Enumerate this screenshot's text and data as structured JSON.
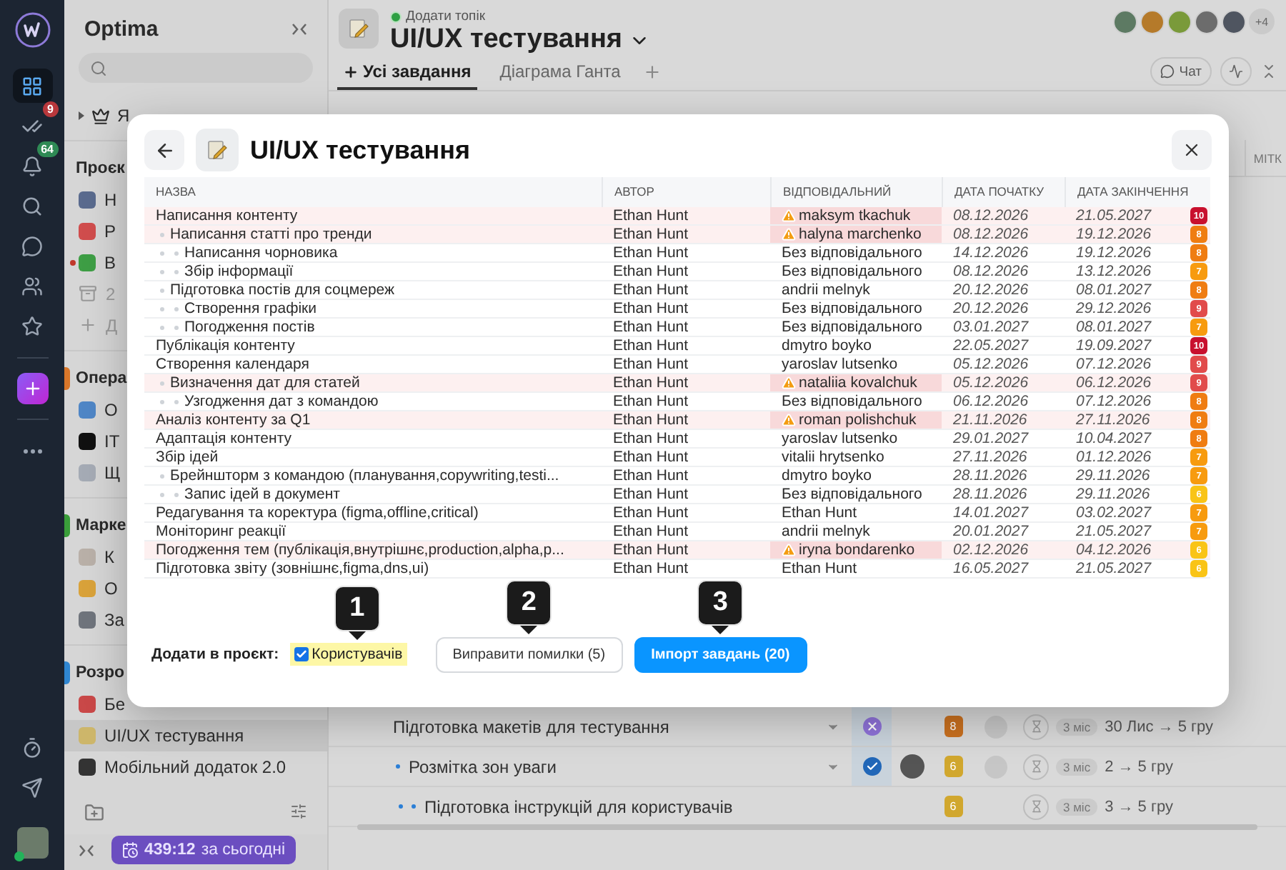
{
  "rail": {
    "top": [
      {
        "kind": "grid",
        "selected": true
      },
      {
        "kind": "tasks",
        "selected": false,
        "badge": "9",
        "color": "#b8383c"
      },
      {
        "kind": "bell",
        "selected": false,
        "badge": "64",
        "color": "#2f8a55"
      },
      {
        "kind": "search",
        "selected": false
      },
      {
        "kind": "chat",
        "selected": false
      },
      {
        "kind": "users",
        "selected": false
      },
      {
        "kind": "star",
        "selected": false
      }
    ],
    "middle": [
      {
        "kind": "add",
        "selected": false
      },
      {
        "kind": "more",
        "selected": false
      }
    ],
    "bottom": [
      {
        "kind": "timer",
        "selected": false
      },
      {
        "kind": "send",
        "selected": false
      }
    ]
  },
  "sidebar": {
    "title": "Optima",
    "favorites": {
      "label": "Я"
    },
    "sections": [
      {
        "label": "Проєк",
        "items": [
          {
            "label": "Н",
            "kind": "project",
            "color": "#5a6b8e",
            "selected": false,
            "unread": false
          },
          {
            "label": "Р",
            "kind": "project",
            "color": "#d04d4d",
            "selected": false,
            "unread": false
          },
          {
            "label": "В",
            "kind": "project",
            "color": "#3e9e45",
            "selected": false,
            "unread": true
          },
          {
            "label": "2",
            "kind": "archive",
            "selected": false,
            "unread": false
          },
          {
            "label": "Д",
            "kind": "add",
            "selected": false,
            "unread": false
          }
        ]
      },
      {
        "label": "Опера",
        "color": "#d9772a",
        "items": [
          {
            "label": "О",
            "kind": "project",
            "color": "#4f86c6",
            "selected": false,
            "unread": false
          },
          {
            "label": "IT",
            "kind": "project",
            "color": "#111111",
            "selected": false,
            "unread": false
          },
          {
            "label": "Щ",
            "kind": "project",
            "color": "#a5abb5",
            "selected": false,
            "unread": false
          }
        ]
      },
      {
        "label": "Марке",
        "color": "#3a9e3a",
        "items": [
          {
            "label": "К",
            "kind": "project",
            "color": "#b9b0a8",
            "selected": false,
            "unread": false
          },
          {
            "label": "О",
            "kind": "project",
            "color": "#d9a23a",
            "selected": false,
            "unread": false
          },
          {
            "label": "За",
            "kind": "project",
            "color": "#6f747c",
            "selected": false,
            "unread": false
          }
        ]
      },
      {
        "label": "Розро",
        "color": "#2f86d1",
        "items": [
          {
            "label": "Бе",
            "kind": "project",
            "color": "#c94848",
            "selected": false,
            "unread": false
          },
          {
            "label": "UI/UX тестування",
            "kind": "project",
            "color": "#cdb66a",
            "selected": true,
            "unread": false
          },
          {
            "label": "Мобільний додаток 2.0",
            "kind": "project",
            "color": "#333333",
            "selected": false,
            "unread": false
          }
        ]
      }
    ],
    "timer": {
      "value": "439:12",
      "label": "за сьогодні"
    }
  },
  "header": {
    "topic": "Додати топік",
    "title": "UI/UX тестування",
    "members_more": "+4",
    "chat": "Чат"
  },
  "tabs": [
    {
      "label": "Усі завдання",
      "selected": true,
      "kind": "all"
    },
    {
      "label": "Діаграма Ганта",
      "selected": false,
      "kind": "gantt"
    }
  ],
  "grid": {
    "column_label": "МІТК",
    "rows": [
      {
        "name": "Підготовка макетів для тестування",
        "kind": "cancelled",
        "assignee": false,
        "priority": "8",
        "color": "#c9701f",
        "duration": "3 міс",
        "dates": "30 Лис → 5 гру",
        "children": [
          {
            "name": "Розмітка зон уваги",
            "kind": "done",
            "assignee": true,
            "priority": "6",
            "color": "#d1a72e",
            "duration": "3 міс",
            "dates": "2 → 5 гру",
            "children": [
              {
                "name": "Підготовка інструкцій для користувачів",
                "kind": "plain",
                "assignee": false,
                "priority": "6",
                "color": "#d1a72e",
                "duration": "3 міс",
                "dates": "3 → 5 гру"
              }
            ]
          }
        ]
      }
    ]
  },
  "dialog": {
    "title": "UI/UX тестування",
    "columns": [
      "НАЗВА",
      "АВТОР",
      "ВІДПОВІДАЛЬНИЙ",
      "ДАТА ПОЧАТКУ",
      "ДАТА ЗАКІНЧЕННЯ"
    ],
    "rows": [
      {
        "name": "Написання контенту",
        "author": "Ethan Hunt",
        "assignee": "maksym tkachuk",
        "warning": true,
        "start": "08.12.2026",
        "end": "21.05.2027",
        "priority": "10",
        "color": "#c8102e",
        "children": [
          {
            "name": "Написання статті про тренди",
            "author": "Ethan Hunt",
            "assignee": "halyna marchenko",
            "warning": true,
            "start": "08.12.2026",
            "end": "19.12.2026",
            "priority": "8",
            "color": "#ef7d12",
            "children": [
              {
                "name": "Написання чорновика",
                "author": "Ethan Hunt",
                "assignee": "Без відповідального",
                "warning": false,
                "start": "14.12.2026",
                "end": "19.12.2026",
                "priority": "8",
                "color": "#ef7d12"
              },
              {
                "name": "Збір інформації",
                "author": "Ethan Hunt",
                "assignee": "Без відповідального",
                "warning": false,
                "start": "08.12.2026",
                "end": "13.12.2026",
                "priority": "7",
                "color": "#f79b0f"
              }
            ]
          },
          {
            "name": "Підготовка постів для соцмереж",
            "author": "Ethan Hunt",
            "assignee": "andrii melnyk",
            "warning": false,
            "start": "20.12.2026",
            "end": "08.01.2027",
            "priority": "8",
            "color": "#ef7d12",
            "children": [
              {
                "name": "Створення графіки",
                "author": "Ethan Hunt",
                "assignee": "Без відповідального",
                "warning": false,
                "start": "20.12.2026",
                "end": "29.12.2026",
                "priority": "9",
                "color": "#e14b4b"
              },
              {
                "name": "Погодження постів",
                "author": "Ethan Hunt",
                "assignee": "Без відповідального",
                "warning": false,
                "start": "03.01.2027",
                "end": "08.01.2027",
                "priority": "7",
                "color": "#f79b0f"
              }
            ]
          }
        ]
      },
      {
        "name": "Публікація контенту",
        "author": "Ethan Hunt",
        "assignee": "dmytro boyko",
        "warning": false,
        "start": "22.05.2027",
        "end": "19.09.2027",
        "priority": "10",
        "color": "#c8102e"
      },
      {
        "name": "Створення календаря",
        "author": "Ethan Hunt",
        "assignee": "yaroslav lutsenko",
        "warning": false,
        "start": "05.12.2026",
        "end": "07.12.2026",
        "priority": "9",
        "color": "#e14b4b",
        "children": [
          {
            "name": "Визначення дат для статей",
            "author": "Ethan Hunt",
            "assignee": "nataliia kovalchuk",
            "warning": true,
            "start": "05.12.2026",
            "end": "06.12.2026",
            "priority": "9",
            "color": "#e14b4b",
            "children": [
              {
                "name": "Узгодження дат з командою",
                "author": "Ethan Hunt",
                "assignee": "Без відповідального",
                "warning": false,
                "start": "06.12.2026",
                "end": "07.12.2026",
                "priority": "8",
                "color": "#ef7d12"
              }
            ]
          }
        ]
      },
      {
        "name": "Аналіз контенту за Q1",
        "author": "Ethan Hunt",
        "assignee": "roman polishchuk",
        "warning": true,
        "start": "21.11.2026",
        "end": "27.11.2026",
        "priority": "8",
        "color": "#ef7d12"
      },
      {
        "name": "Адаптація контенту",
        "author": "Ethan Hunt",
        "assignee": "yaroslav lutsenko",
        "warning": false,
        "start": "29.01.2027",
        "end": "10.04.2027",
        "priority": "8",
        "color": "#ef7d12"
      },
      {
        "name": "Збір ідей",
        "author": "Ethan Hunt",
        "assignee": "vitalii hrytsenko",
        "warning": false,
        "start": "27.11.2026",
        "end": "01.12.2026",
        "priority": "7",
        "color": "#f79b0f",
        "children": [
          {
            "name": "Брейншторм з командою (планування,copywriting,testi...",
            "author": "Ethan Hunt",
            "assignee": "dmytro boyko",
            "warning": false,
            "start": "28.11.2026",
            "end": "29.11.2026",
            "priority": "7",
            "color": "#f79b0f",
            "children": [
              {
                "name": "Запис ідей в документ",
                "author": "Ethan Hunt",
                "assignee": "Без відповідального",
                "warning": false,
                "start": "28.11.2026",
                "end": "29.11.2026",
                "priority": "6",
                "color": "#f9c416"
              }
            ]
          }
        ]
      },
      {
        "name": "Редагування та коректура (figma,offline,critical)",
        "author": "Ethan Hunt",
        "assignee": "Ethan Hunt",
        "warning": false,
        "start": "14.01.2027",
        "end": "03.02.2027",
        "priority": "7",
        "color": "#f79b0f"
      },
      {
        "name": "Моніторинг реакції",
        "author": "Ethan Hunt",
        "assignee": "andrii melnyk",
        "warning": false,
        "start": "20.01.2027",
        "end": "21.05.2027",
        "priority": "7",
        "color": "#f79b0f"
      },
      {
        "name": "Погодження тем (публікація,внутрішнє,production,alpha,p...",
        "author": "Ethan Hunt",
        "assignee": "iryna bondarenko",
        "warning": true,
        "start": "02.12.2026",
        "end": "04.12.2026",
        "priority": "6",
        "color": "#f9c416"
      },
      {
        "name": "Підготовка звіту (зовнішнє,figma,dns,ui)",
        "author": "Ethan Hunt",
        "assignee": "Ethan Hunt",
        "warning": false,
        "start": "16.05.2027",
        "end": "21.05.2027",
        "priority": "6",
        "color": "#f9c416"
      }
    ],
    "footer": {
      "label": "Додати в проєкт:",
      "checkbox": {
        "label": "Користувачів",
        "checked": true
      },
      "buttons": [
        {
          "label": "Виправити помилки (5)",
          "kind": "secondary"
        },
        {
          "label": "Імпорт завдань (20)",
          "kind": "primary"
        }
      ]
    },
    "callouts": [
      "1",
      "2",
      "3"
    ]
  }
}
